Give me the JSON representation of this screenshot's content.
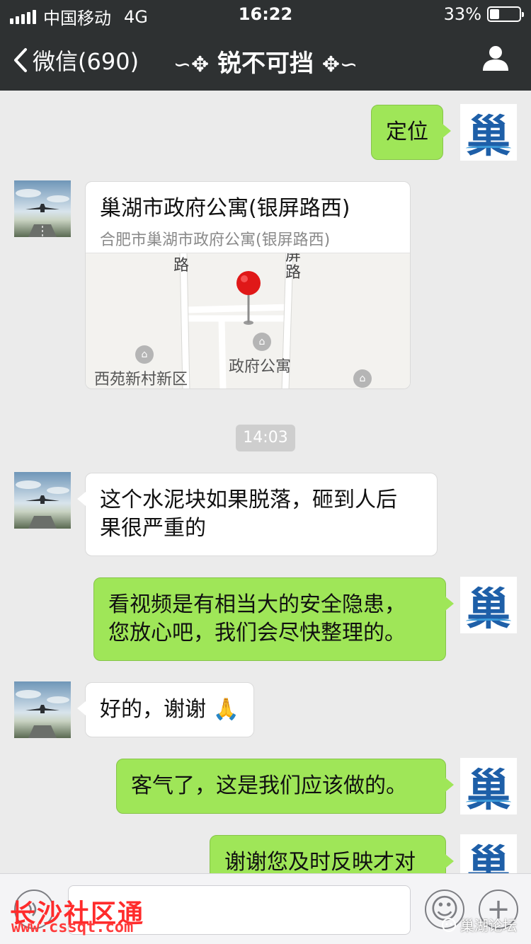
{
  "status_bar": {
    "carrier": "中国移动",
    "network": "4G",
    "time": "16:22",
    "battery_text": "33%",
    "battery_level": 0.33
  },
  "nav": {
    "back_label": "微信(690)",
    "title": "锐不可挡",
    "title_ornament_left": "∽✥",
    "title_ornament_right": "✥∽"
  },
  "messages": {
    "m1": {
      "sender": "me",
      "text": "定位"
    },
    "m2": {
      "sender": "other",
      "type": "location",
      "title": "巢湖市政府公寓(银屏路西)",
      "address": "合肥市巢湖市政府公寓(银屏路西)",
      "map_labels": {
        "road_left": "路",
        "road_right": "屏\n路",
        "poi_center": "政府公寓",
        "poi_left": "西苑新村新区"
      }
    },
    "timestamp": "14:03",
    "m3": {
      "sender": "other",
      "line1": "这个水泥块如果脱落，砸到人后",
      "line2": "果很严重的"
    },
    "m4": {
      "sender": "me",
      "line1": "看视频是有相当大的安全隐患，",
      "line2": "您放心吧，我们会尽快整理的。"
    },
    "m5": {
      "sender": "other",
      "text": "好的，谢谢",
      "emoji": "🙏"
    },
    "m6": {
      "sender": "me",
      "text": "客气了，这是我们应该做的。"
    },
    "m7": {
      "sender": "me",
      "text": "谢谢您及时反映才对"
    }
  },
  "avatars": {
    "me_glyph": "巢"
  },
  "input_bar": {
    "emoji_button": "☺",
    "plus_button": "+"
  },
  "watermarks": {
    "left_title": "长沙社区通",
    "left_url": "www.cssqt.com",
    "right": "巢湖论坛"
  },
  "colors": {
    "bar": "#2e3132",
    "out_bubble": "#9fe658",
    "in_bubble": "#ffffff",
    "bg": "#ebebeb"
  }
}
